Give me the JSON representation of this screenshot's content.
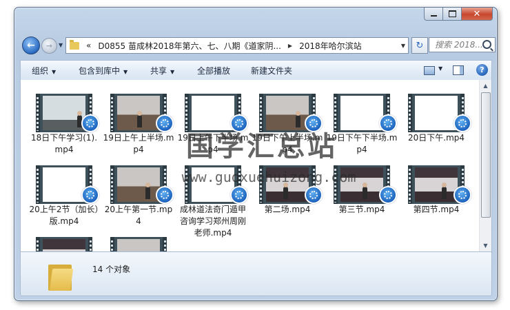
{
  "navigation": {
    "address_parts": [
      "«",
      "D0855 苗成林2018年第六、七、八期《道家阴...",
      "2018年哈尔滨站"
    ],
    "search_placeholder": "搜索 2018..."
  },
  "toolbar": {
    "organize": "组织",
    "include_in_library": "包含到库中",
    "share": "共享",
    "play_all": "全部播放",
    "new_folder": "新建文件夹"
  },
  "files": [
    {
      "name": "18日下午学习(1).mp4",
      "thumb": "board"
    },
    {
      "name": "19日上午上半场.mp4",
      "thumb": "dark"
    },
    {
      "name": "19日上午下半场.mp4",
      "thumb": "white"
    },
    {
      "name": "19日下午上半场.mp4",
      "thumb": "dark"
    },
    {
      "name": "19日下午下半场.mp4",
      "thumb": "white"
    },
    {
      "name": "20日下午.mp4",
      "thumb": "white"
    },
    {
      "name": "20上午2节（加长）版.mp4",
      "thumb": "white"
    },
    {
      "name": "20上午第一节.mp4",
      "thumb": "dark"
    },
    {
      "name": "成林道法奇门遁甲咨询学习郑州周刚老师.mp4",
      "thumb": "white"
    },
    {
      "name": "第二场.mp4",
      "thumb": "stage"
    },
    {
      "name": "第三节.mp4",
      "thumb": "stage"
    },
    {
      "name": "第四节.mp4",
      "thumb": "stage"
    },
    {
      "name": "",
      "thumb": "stage"
    },
    {
      "name": "",
      "thumb": "dark"
    }
  ],
  "details_pane": {
    "item_count": "14 个对象"
  },
  "watermark": {
    "text": "国学汇总站",
    "url": "www.guoxuehuizong.com"
  }
}
